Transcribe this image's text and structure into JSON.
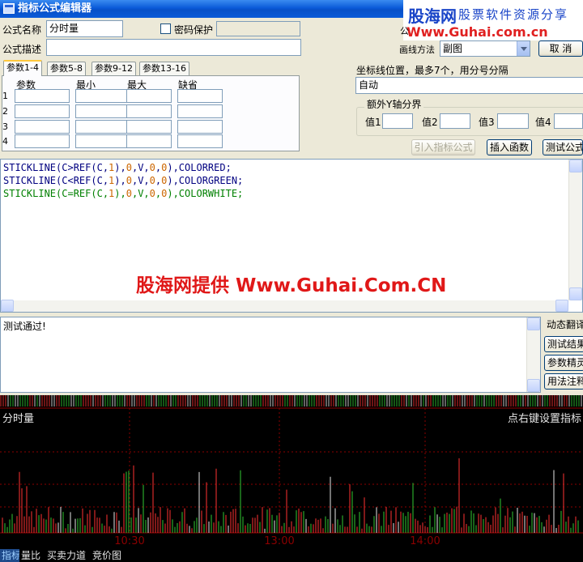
{
  "window": {
    "title": "指标公式编辑器"
  },
  "banner": {
    "brand": "股海网",
    "slogan": "股票软件资源分享",
    "url": "Www.Guhai.com.cn"
  },
  "form": {
    "name_label": "公式名称",
    "name_value": "分时量",
    "password_label": "密码保护",
    "desc_label": "公式描述",
    "right_label_partial": "公",
    "draw_method_label": "画线方法",
    "draw_method_value": "副图",
    "cancel_label": "取 消"
  },
  "tabs": [
    {
      "label": "参数1-4",
      "active": true
    },
    {
      "label": "参数5-8",
      "active": false
    },
    {
      "label": "参数9-12",
      "active": false
    },
    {
      "label": "参数13-16",
      "active": false
    }
  ],
  "param_table": {
    "headers": [
      "参数",
      "最小",
      "最大",
      "缺省"
    ],
    "rows": [
      "1",
      "2",
      "3",
      "4"
    ]
  },
  "axis": {
    "label": "坐标线位置，最多7个，用分号分隔",
    "value": "自动",
    "extra_group_label": "额外Y轴分界",
    "values": [
      "值1",
      "值2",
      "值3",
      "值4"
    ]
  },
  "buttons": {
    "import": "引入指标公式",
    "insert_func": "插入函数",
    "test": "测试公式"
  },
  "code_lines": [
    [
      "STICKLINE(C>REF(C,",
      "1",
      "),",
      "0",
      ",V,",
      "0",
      ",",
      "0",
      "),COLORRED;"
    ],
    [
      "STICKLINE(C<REF(C,",
      "1",
      "),",
      "0",
      ",V,",
      "0",
      ",",
      "0",
      "),COLORGREEN;"
    ],
    [
      "STICKLINE(C=REF(C,",
      "1",
      "),",
      "0",
      ",V,",
      "0",
      ",",
      "0",
      "),COLORWHITE;"
    ]
  ],
  "watermark": "股海网提供 Www.Guhai.Com.CN",
  "output_text": "测试通过!",
  "side_buttons": [
    "动态翻译",
    "测试结果",
    "参数精灵",
    "用法注释"
  ],
  "chart": {
    "title": "分时量",
    "hint": "点右键设置指标",
    "x_ticks": [
      "10:30",
      "13:00",
      "14:00"
    ]
  },
  "bottom_tabs": [
    {
      "label": "指标",
      "active": true
    },
    {
      "label": "量比",
      "active": false
    },
    {
      "label": "买卖力道",
      "active": false
    },
    {
      "label": "竞价图",
      "active": false
    }
  ],
  "colors": {
    "up": "#ff3232",
    "down": "#32c832",
    "flat": "#e6e6e6",
    "axis": "#8b0000"
  }
}
